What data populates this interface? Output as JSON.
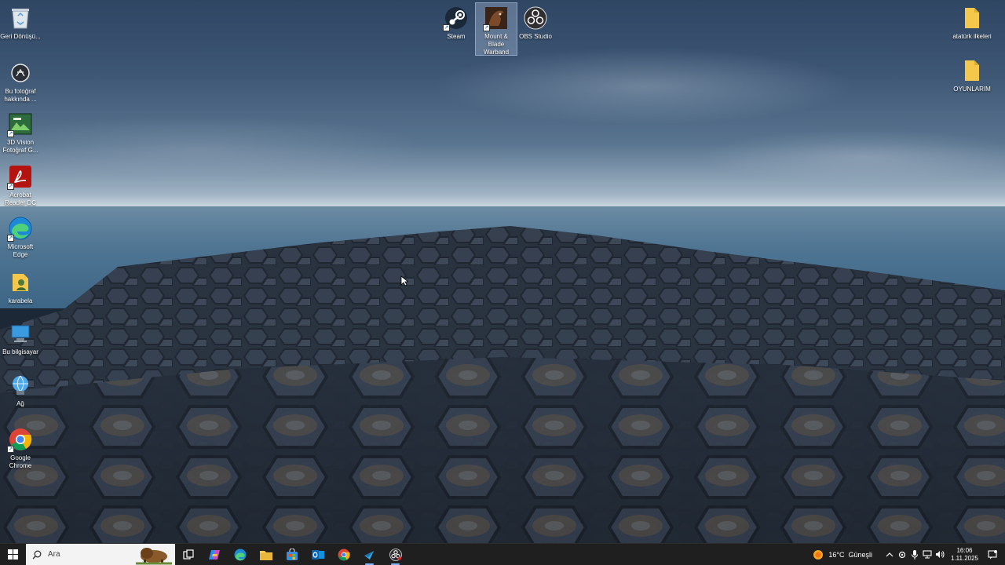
{
  "desktop": {
    "left_icons": [
      {
        "name": "recycle-bin",
        "label": "Geri Dönüşü..."
      },
      {
        "name": "about-photo",
        "label": "Bu fotoğraf hakkında ..."
      },
      {
        "name": "3d-vision",
        "label": "3D Vision Fotoğraf G..."
      },
      {
        "name": "acrobat",
        "label": "Acrobat Reader DC"
      },
      {
        "name": "edge",
        "label": "Microsoft Edge"
      },
      {
        "name": "karabela",
        "label": "karabela"
      },
      {
        "name": "this-pc",
        "label": "Bu bilgisayar"
      },
      {
        "name": "network",
        "label": "Ağ"
      },
      {
        "name": "chrome",
        "label": "Google Chrome"
      }
    ],
    "top_icons": [
      {
        "name": "steam",
        "label": "Steam"
      },
      {
        "name": "mount-blade",
        "label": "Mount & Blade Warband"
      },
      {
        "name": "obs",
        "label": "OBS Studio"
      }
    ],
    "right_icons": [
      {
        "name": "ataturk",
        "label": "atatürk ilkeleri"
      },
      {
        "name": "oyunlarim",
        "label": "OYUNLARIM"
      }
    ]
  },
  "taskbar": {
    "search_placeholder": "Ara",
    "pinned": [
      "start-icon",
      "task-view-icon",
      "copilot-icon",
      "edge-icon",
      "file-explorer-icon",
      "store-icon",
      "outlook-icon",
      "chrome-icon",
      "steam-icon",
      "obs-icon"
    ],
    "weather": {
      "temp": "16°C",
      "desc": "Güneşli"
    },
    "time": "16:06",
    "date": "1.11.2025"
  },
  "colors": {
    "taskbar_bg": "#1f1f1f",
    "accent": "#7fb4ff",
    "folder": "#f5c84c"
  }
}
